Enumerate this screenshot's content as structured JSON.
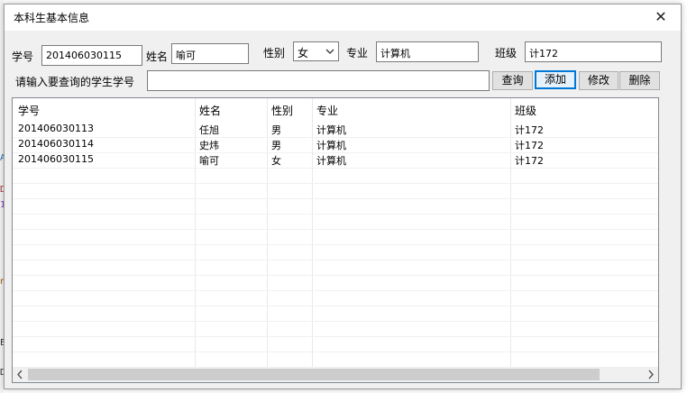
{
  "window": {
    "title": "本科生基本信息",
    "close_glyph": "✕"
  },
  "form": {
    "student_id_label": "学号",
    "student_id_value": "201406030115",
    "name_label": "姓名",
    "name_value": "喻可",
    "gender_label": "性别",
    "gender_value": "女",
    "major_label": "专业",
    "major_value": "计算机",
    "class_label": "班级",
    "class_value": "计172",
    "search_prompt_label": "请输入要查询的学生学号",
    "search_value": ""
  },
  "buttons": {
    "query": "查询",
    "add": "添加",
    "modify": "修改",
    "delete": "删除"
  },
  "table": {
    "columns": [
      "学号",
      "姓名",
      "性别",
      "专业",
      "班级"
    ],
    "rows": [
      [
        "201406030113",
        "任旭",
        "男",
        "计算机",
        "计172"
      ],
      [
        "201406030114",
        "史炜",
        "男",
        "计算机",
        "计172"
      ],
      [
        "201406030115",
        "喻可",
        "女",
        "计算机",
        "计172"
      ]
    ]
  },
  "colors": {
    "accent": "#0078d7",
    "dialog_bg": "#f0f0f0",
    "scroll_thumb": "#cdcdcd"
  }
}
